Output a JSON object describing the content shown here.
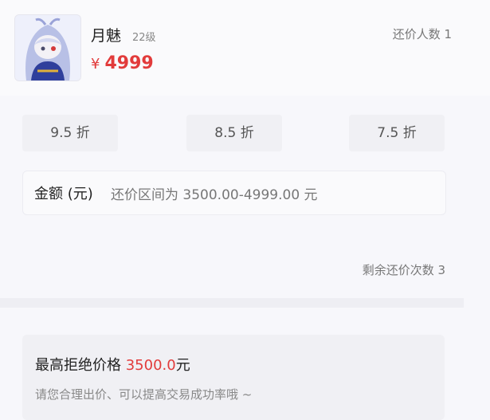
{
  "item": {
    "name": "月魅",
    "level": "22级",
    "currency": "¥",
    "price": "4999",
    "bargain_count_label": "还价人数 1"
  },
  "discounts": [
    {
      "label": "9.5 折"
    },
    {
      "label": "8.5 折"
    },
    {
      "label": "7.5 折"
    }
  ],
  "amount": {
    "label": "金额 (元)",
    "placeholder": "还价区间为 3500.00-4999.00 元"
  },
  "remaining": "剩余还价次数 3",
  "notice": {
    "title_prefix": "最高拒绝价格 ",
    "title_value": "3500.0",
    "title_suffix": "元",
    "hint": "请您合理出价、可以提高交易成功率哦 ~"
  },
  "colors": {
    "accent_red": "#e23b3b",
    "avatar_hair": "#b8c0e6",
    "avatar_body": "#2f3f9c"
  }
}
